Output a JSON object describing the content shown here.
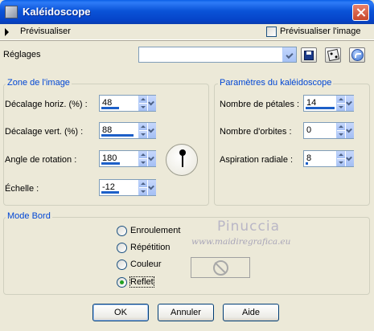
{
  "window": {
    "title": "Kaléidoscope"
  },
  "preview": {
    "label": "Prévisualiser",
    "checkbox_label": "Prévisualiser l'image",
    "checked": false
  },
  "presets": {
    "label": "Réglages",
    "value": ""
  },
  "image_zone": {
    "legend": "Zone de l'image",
    "fields": [
      {
        "label": "Décalage horiz. (%) :",
        "value": "48",
        "level": 0.48
      },
      {
        "label": "Décalage vert. (%) :",
        "value": "88",
        "level": 0.88
      },
      {
        "label": "Angle de rotation :",
        "value": "180",
        "level": 0.5
      },
      {
        "label": "Échelle :",
        "value": "-12",
        "level": 0.47
      }
    ]
  },
  "kaleido_params": {
    "legend": "Paramètres du kaléidoscope",
    "fields": [
      {
        "label": "Nombre de pétales :",
        "value": "14",
        "level": 0.95
      },
      {
        "label": "Nombre d'orbites :",
        "value": "0",
        "level": 0.0
      },
      {
        "label": "Aspiration radiale :",
        "value": "8",
        "level": 0.08
      }
    ]
  },
  "edge_mode": {
    "legend": "Mode Bord",
    "options": [
      "Enroulement",
      "Répétition",
      "Couleur",
      "Reflet"
    ],
    "selected": "Reflet"
  },
  "watermark": {
    "line1": "Pinuccia",
    "line2": "www.maidiregrafica.eu"
  },
  "buttons": {
    "ok": "OK",
    "cancel": "Annuler",
    "help": "Aide"
  },
  "colors": {
    "title_bar": "#0A53D8",
    "dialog_bg": "#ECE9D8",
    "accent": "#0046D5",
    "slider_fill": "#1C5FC8"
  }
}
